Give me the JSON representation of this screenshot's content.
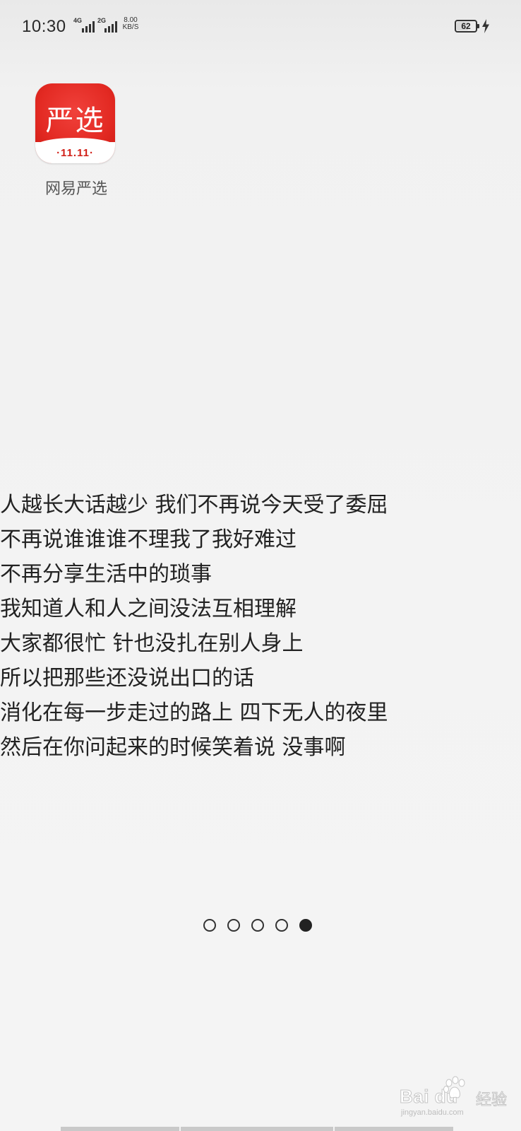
{
  "status_bar": {
    "time": "10:30",
    "network_1": "4G",
    "network_2": "2G",
    "speed_value": "8.00",
    "speed_unit": "KB/S",
    "battery_level": "62",
    "battery_fraction": 0.62,
    "icons": [
      "signal-4g-icon",
      "signal-2g-icon",
      "battery-icon",
      "charging-icon"
    ]
  },
  "app": {
    "icon_text": "严选",
    "icon_promo": "·11.11·",
    "label": "网易严选",
    "brand_color": "#e32a23"
  },
  "content": {
    "lines": [
      "人越长大话越少 我们不再说今天受了委屈",
      "不再说谁谁谁不理我了我好难过",
      "不再分享生活中的琐事",
      "我知道人和人之间没法互相理解",
      "大家都很忙 针也没扎在别人身上",
      "所以把那些还没说出口的话",
      "消化在每一步走过的路上 四下无人的夜里",
      "然后在你问起来的时候笑着说 没事啊"
    ]
  },
  "page_indicator": {
    "count": 5,
    "active_index": 4
  },
  "watermark": {
    "brand": "Bai du",
    "suffix": "经验",
    "url": "jingyan.baidu.com"
  }
}
